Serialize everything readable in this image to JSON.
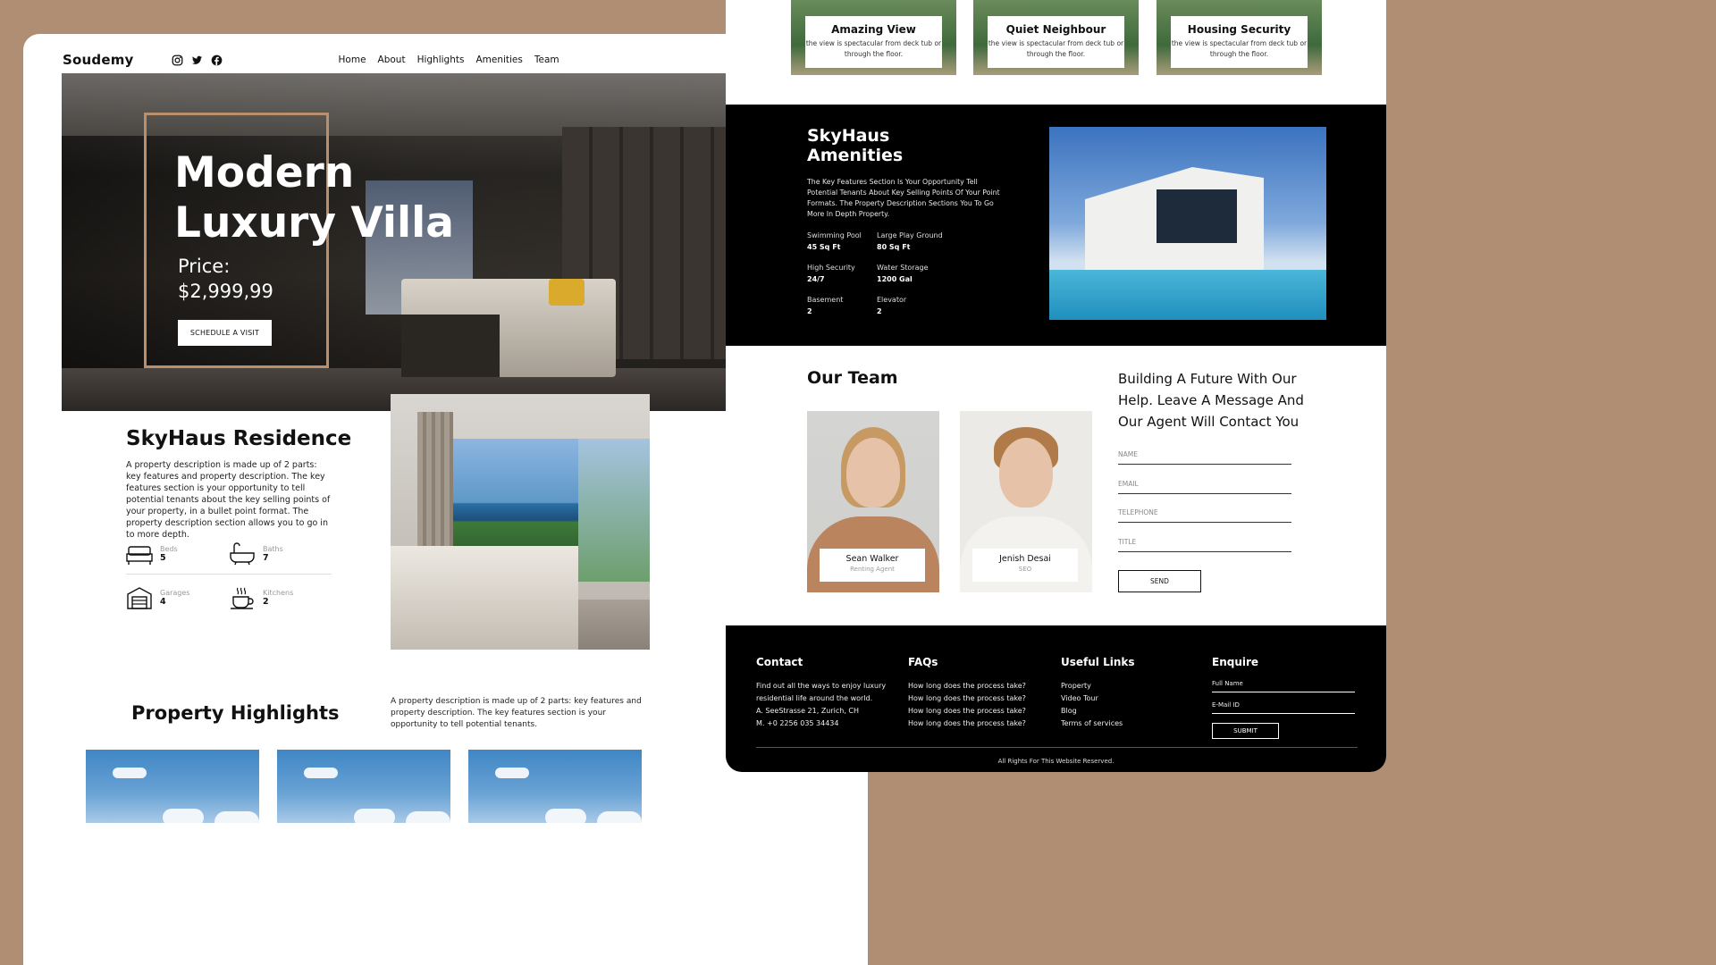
{
  "left": {
    "nav": {
      "logo": "Soudemy",
      "menu": [
        "Home",
        "About",
        "Highlights",
        "Amenities",
        "Team"
      ]
    },
    "hero": {
      "title_line1": "Modern",
      "title_line2": "Luxury Villa",
      "price_label": "Price:",
      "price": "$2,999,99",
      "cta": "SCHEDULE A VISIT"
    },
    "residence": {
      "title": "SkyHaus Residence",
      "description": "A property description is made up of 2 parts: key features and property description. The key features section is your opportunity to tell potential tenants about the key selling points of your property, in a bullet point format. The property description section allows you to go in to more depth.",
      "features": [
        {
          "label": "Beds",
          "value": "5"
        },
        {
          "label": "Baths",
          "value": "7"
        },
        {
          "label": "Garages",
          "value": "4"
        },
        {
          "label": "Kitchens",
          "value": "2"
        }
      ]
    },
    "highlights": {
      "title": "Property Highlights",
      "description": "A property description is made up of 2 parts: key features and property description. The key features section is your opportunity to tell potential tenants."
    }
  },
  "right": {
    "highlight_cards": [
      {
        "title": "Amazing View",
        "text": "the view is spectacular from deck tub or through the floor."
      },
      {
        "title": "Quiet Neighbour",
        "text": "the view is spectacular from deck tub or through the floor."
      },
      {
        "title": "Housing Security",
        "text": "the view is spectacular from deck tub or through the floor."
      }
    ],
    "amenities": {
      "title": "SkyHaus Amenities",
      "description": "The Key Features Section Is Your Opportunity Tell Potential Tenants About Key Selling Points Of Your Point Formats. The Property Description Sections You To Go More In Depth Property.",
      "items": [
        {
          "label": "Swimming Pool",
          "value": "45 Sq Ft"
        },
        {
          "label": "Large Play Ground",
          "value": "80 Sq Ft"
        },
        {
          "label": "High Security",
          "value": "24/7"
        },
        {
          "label": "Water Storage",
          "value": "1200 Gal"
        },
        {
          "label": "Basement",
          "value": "2"
        },
        {
          "label": "Elevator",
          "value": "2"
        }
      ]
    },
    "team": {
      "title": "Our Team",
      "members": [
        {
          "name": "Sean Walker",
          "role": "Renting Agent"
        },
        {
          "name": "Jenish Desai",
          "role": "SEO"
        }
      ]
    },
    "contact": {
      "title": "Building A Future With Our Help. Leave A Message And Our Agent Will Contact You",
      "fields": [
        "NAME",
        "EMAIL",
        "TELEPHONE",
        "TITLE"
      ],
      "send": "SEND"
    },
    "footer": {
      "contact": {
        "heading": "Contact",
        "lines": [
          "Find out all the ways to enjoy luxury",
          "residential life around the world.",
          "A. SeeStrasse 21, Zurich, CH",
          "M. +0 2256 035 34434"
        ]
      },
      "faqs": {
        "heading": "FAQs",
        "items": [
          "How long does the process take?",
          "How long does the process take?",
          "How long does the process take?",
          "How long does the process take?"
        ]
      },
      "links": {
        "heading": "Useful Links",
        "items": [
          "Property",
          "Video Tour",
          "Blog",
          "Terms of services"
        ]
      },
      "enquire": {
        "heading": "Enquire",
        "fields": [
          "Full Name",
          "E-Mail ID"
        ],
        "submit": "SUBMIT"
      },
      "copyright": "All Rights For This Website Reserved."
    }
  }
}
